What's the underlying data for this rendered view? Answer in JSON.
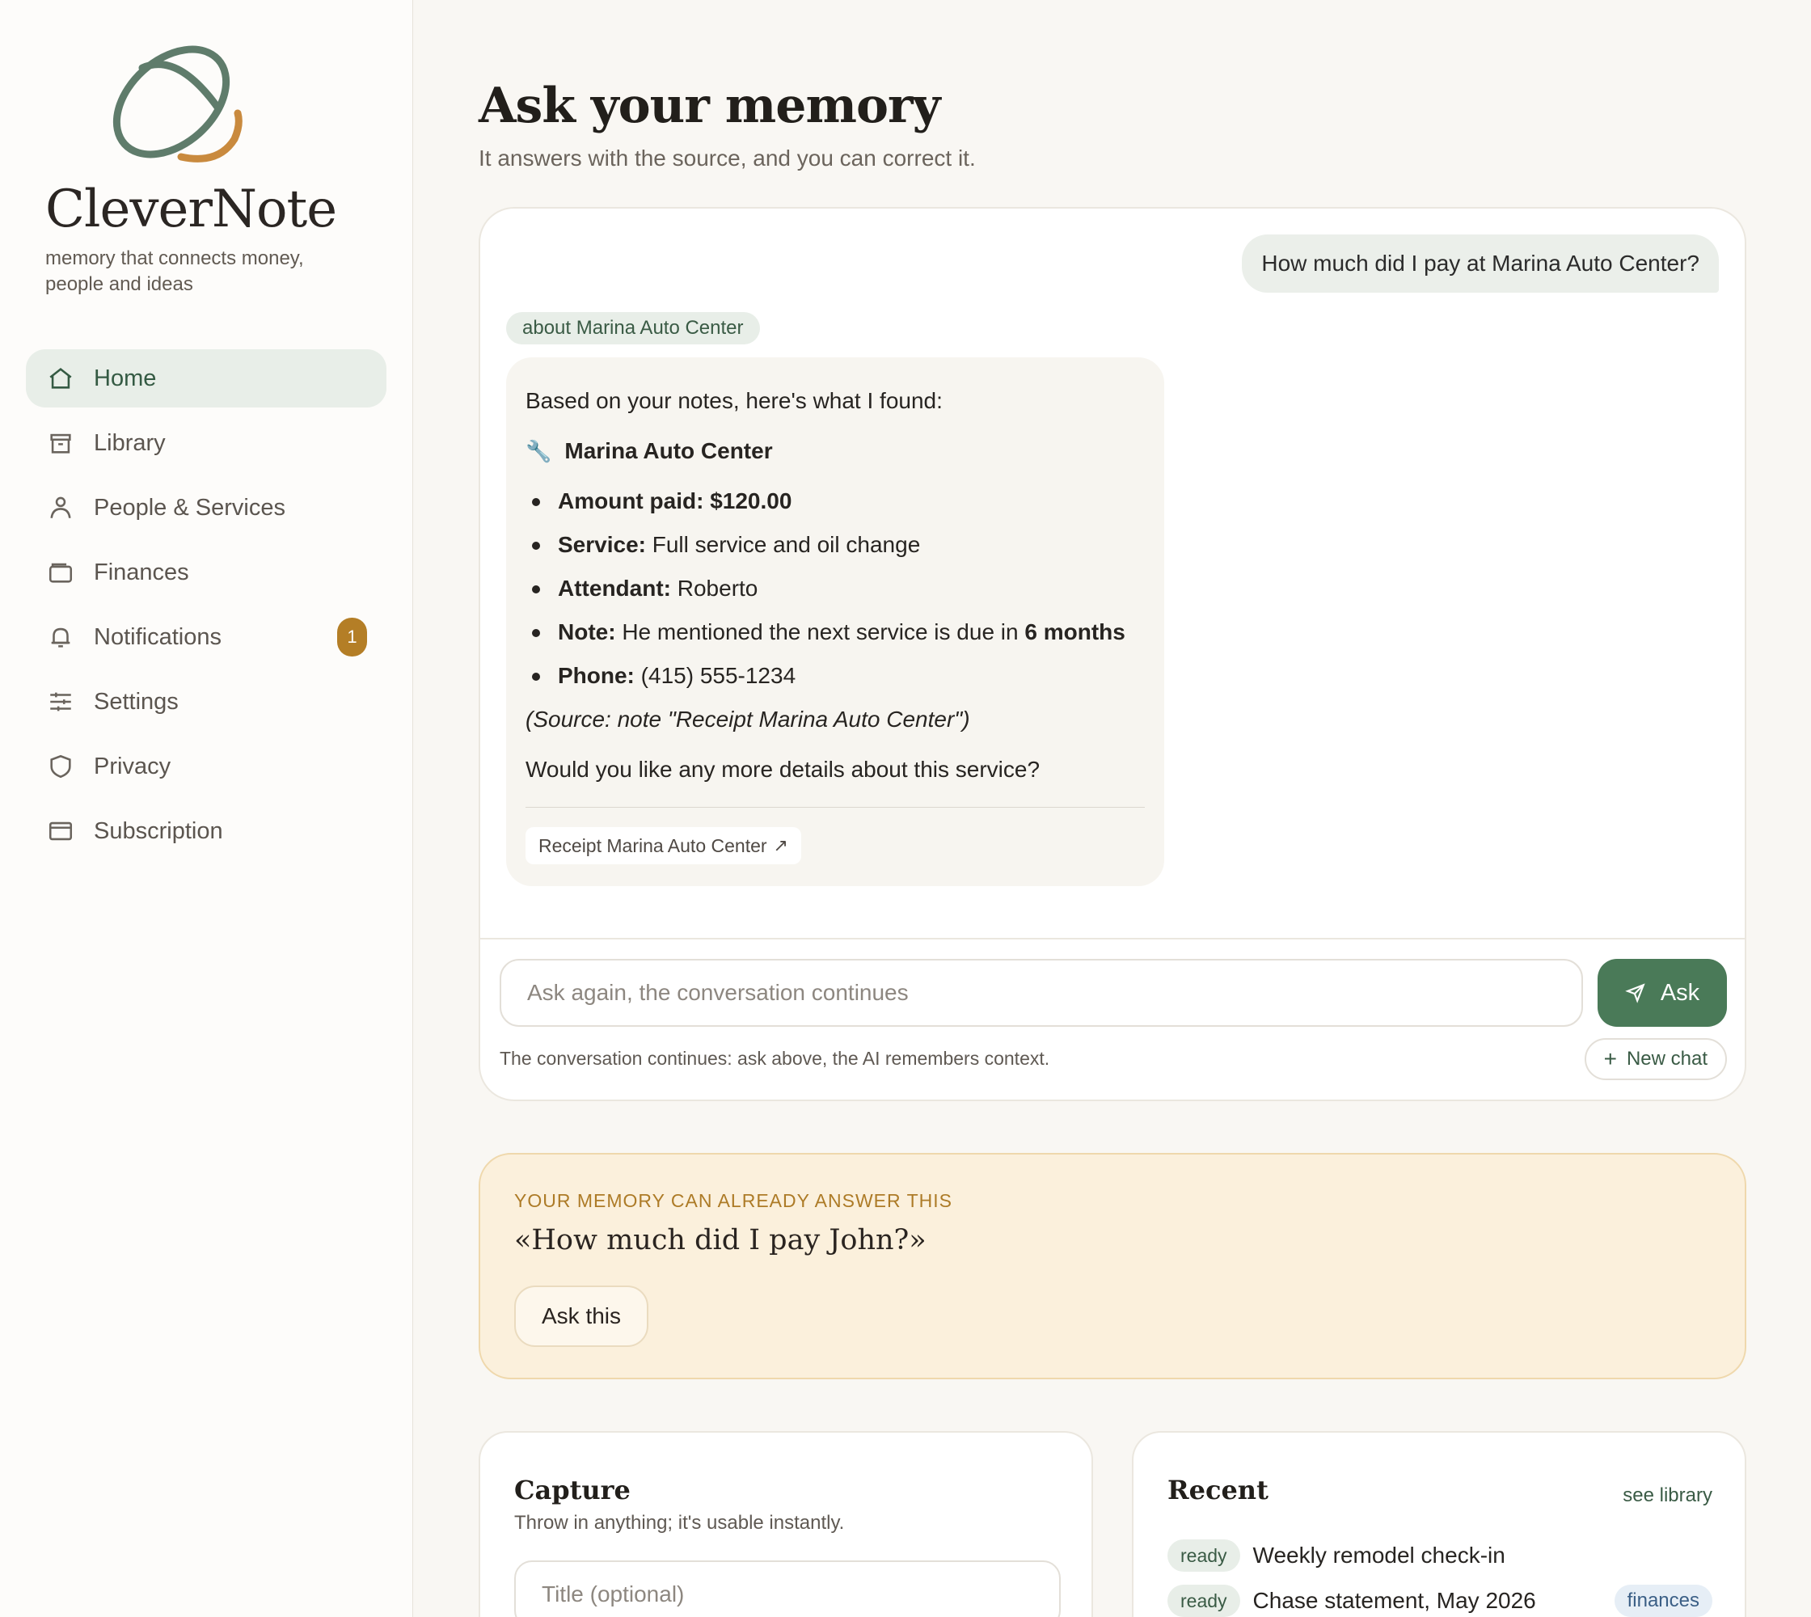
{
  "brand": {
    "name": "CleverNote",
    "tagline": "memory that connects money, people and ideas"
  },
  "nav": {
    "items": [
      {
        "label": "Home",
        "icon": "home-icon",
        "active": true
      },
      {
        "label": "Library",
        "icon": "archive-icon"
      },
      {
        "label": "People & Services",
        "icon": "person-icon"
      },
      {
        "label": "Finances",
        "icon": "wallet-icon"
      },
      {
        "label": "Notifications",
        "icon": "bell-icon",
        "badge": "1"
      },
      {
        "label": "Settings",
        "icon": "sliders-icon"
      },
      {
        "label": "Privacy",
        "icon": "shield-icon"
      },
      {
        "label": "Subscription",
        "icon": "card-icon"
      }
    ]
  },
  "header": {
    "title": "Ask your memory",
    "subtitle": "It answers with the source, and you can correct it."
  },
  "chat": {
    "user_message": "How much did I pay at Marina Auto Center?",
    "about_chip": "about Marina Auto Center",
    "answer": {
      "intro": "Based on your notes, here's what I found:",
      "heading": "Marina Auto Center",
      "items": [
        {
          "label": "Amount paid: $120.00",
          "value": ""
        },
        {
          "label": "Service:",
          "value": " Full service and oil change"
        },
        {
          "label": "Attendant:",
          "value": " Roberto"
        },
        {
          "label": "Note:",
          "value": " He mentioned the next service is due in ",
          "emphasis": "6 months"
        },
        {
          "label": "Phone:",
          "value": " (415) 555-1234"
        }
      ],
      "source": "(Source: note \"Receipt Marina Auto Center\")",
      "followup": "Would you like any more details about this service?",
      "source_chip": "Receipt Marina Auto Center"
    },
    "input_placeholder": "Ask again, the conversation continues",
    "ask_label": "Ask",
    "hint": "The conversation continues: ask above, the AI remembers context.",
    "new_chat_label": "New chat"
  },
  "suggestion": {
    "kicker": "YOUR MEMORY CAN ALREADY ANSWER THIS",
    "question": "«How much did I pay John?»",
    "button": "Ask this"
  },
  "capture": {
    "title": "Capture",
    "subtitle": "Throw in anything; it's usable instantly.",
    "title_placeholder": "Title (optional)"
  },
  "recent": {
    "title": "Recent",
    "see_link": "see library",
    "items": [
      {
        "status": "ready",
        "title": "Weekly remodel check-in",
        "tag": ""
      },
      {
        "status": "ready",
        "title": "Chase statement, May 2026",
        "tag": "finances"
      }
    ]
  },
  "colors": {
    "accent_green": "#4a7a58",
    "badge_amber": "#b47e26",
    "suggestion_bg": "#fbf0dc"
  }
}
